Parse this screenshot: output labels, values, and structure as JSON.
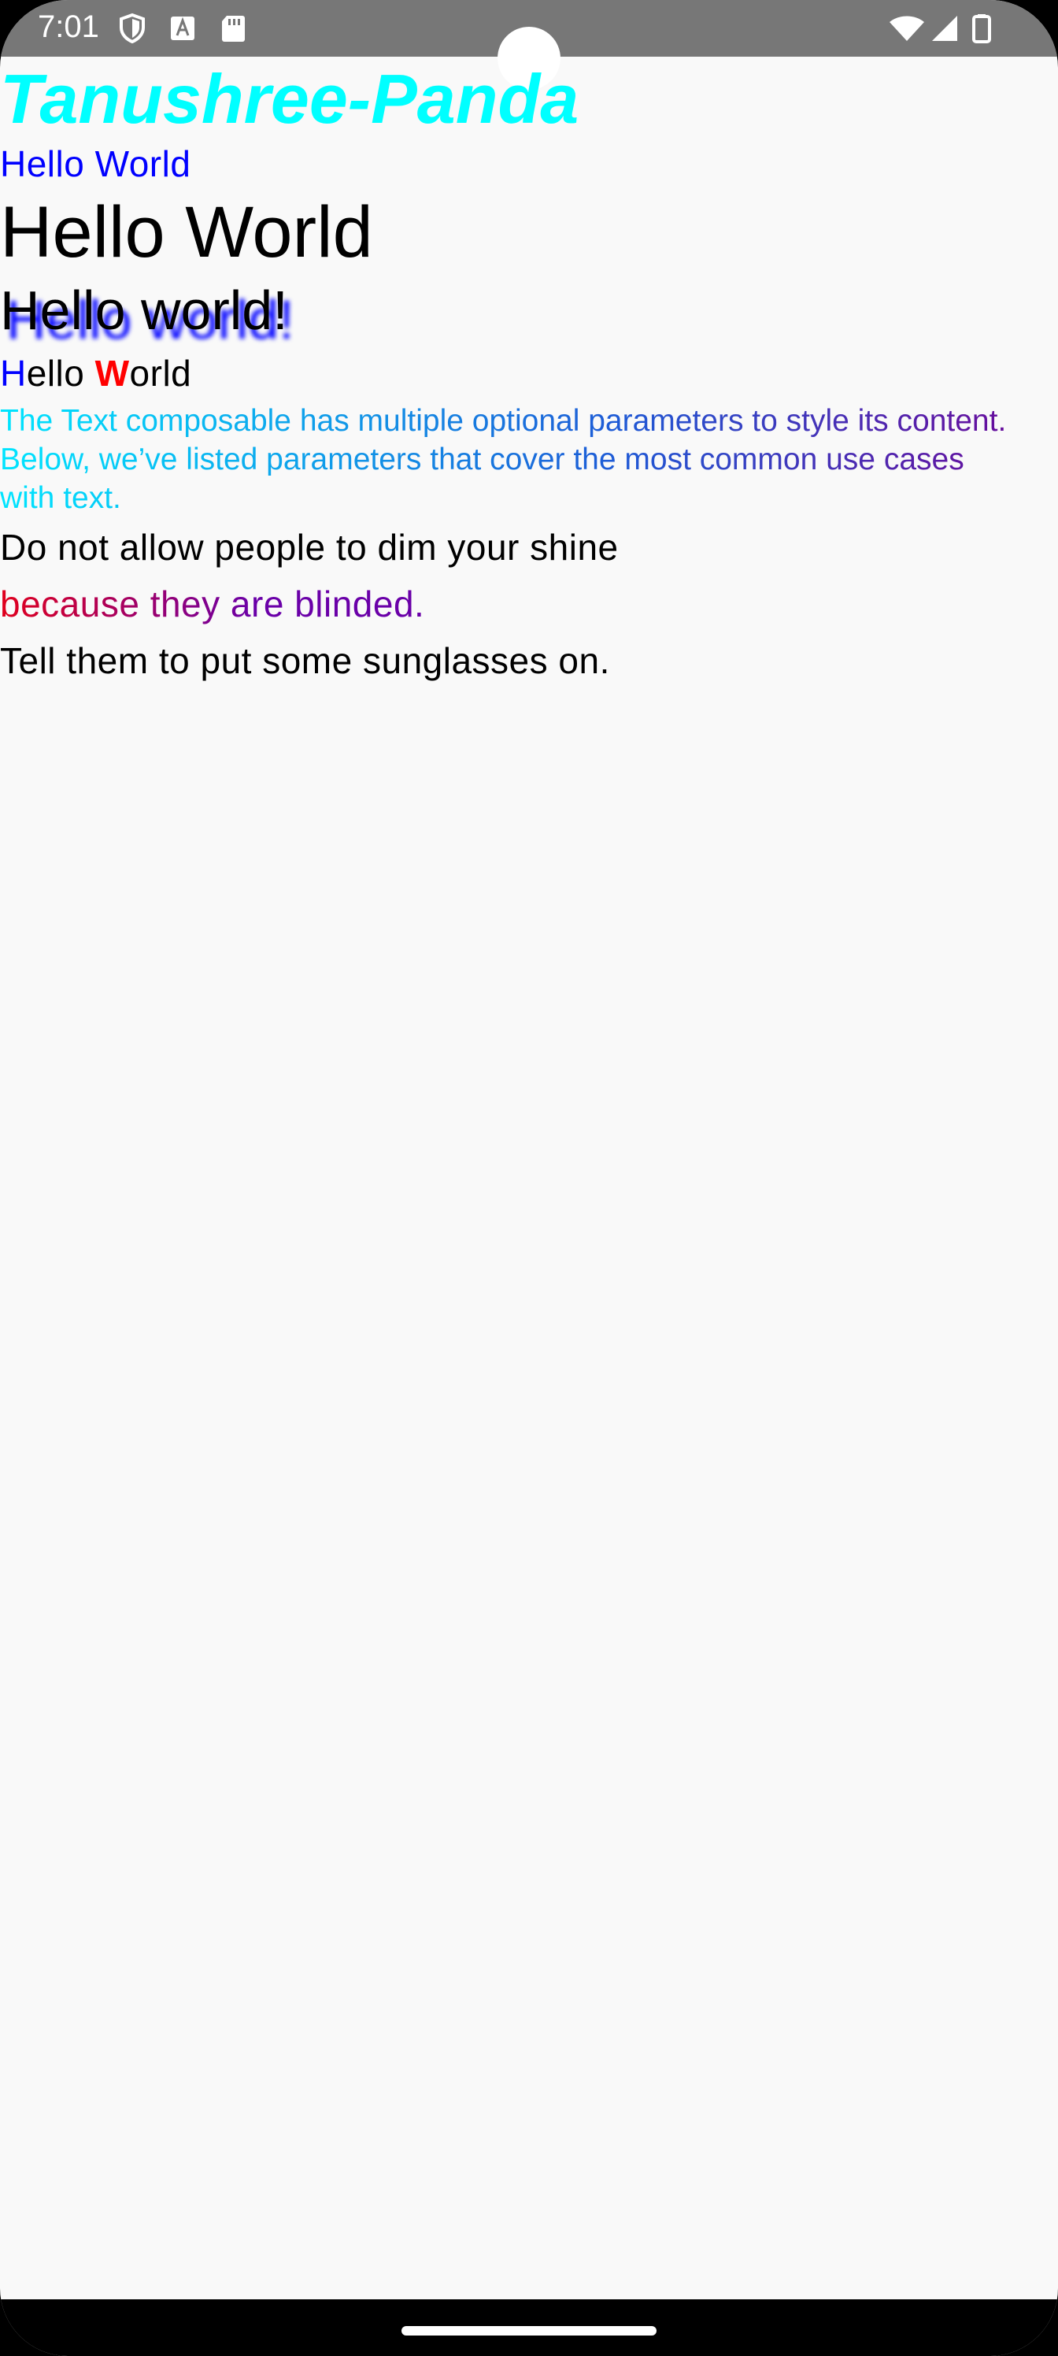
{
  "status_bar": {
    "time": "7:01",
    "left_icons": [
      "shield-icon",
      "text-a-icon",
      "sd-card-icon"
    ],
    "right_icons": [
      "wifi-icon",
      "cell-signal-icon",
      "battery-icon"
    ]
  },
  "content": {
    "brand_title": "Tanushree-Panda",
    "hello_blue": "Hello World",
    "hello_large": "Hello World",
    "hello_shadow": "Hello world!",
    "hello_multi": {
      "part1": "H",
      "part2": "ello ",
      "part3": "W",
      "part4": "orld"
    },
    "gradient_paragraph": "The Text composable has multiple optional parameters to style its content. Below, we’ve listed parameters that cover the most common use cases with text.",
    "shine_line_1": "Do not allow people to dim your shine",
    "shine_line_2": "because they are blinded.",
    "shine_line_3": "Tell them to put some sunglasses on."
  },
  "colors": {
    "brand": "#00ffff",
    "blue": "#0000ff",
    "red": "#ff0000",
    "gradient_start": "#00e5ff",
    "gradient_end": "#6a0a9a",
    "background": "#f9f9f9",
    "status_bar": "#777777"
  }
}
